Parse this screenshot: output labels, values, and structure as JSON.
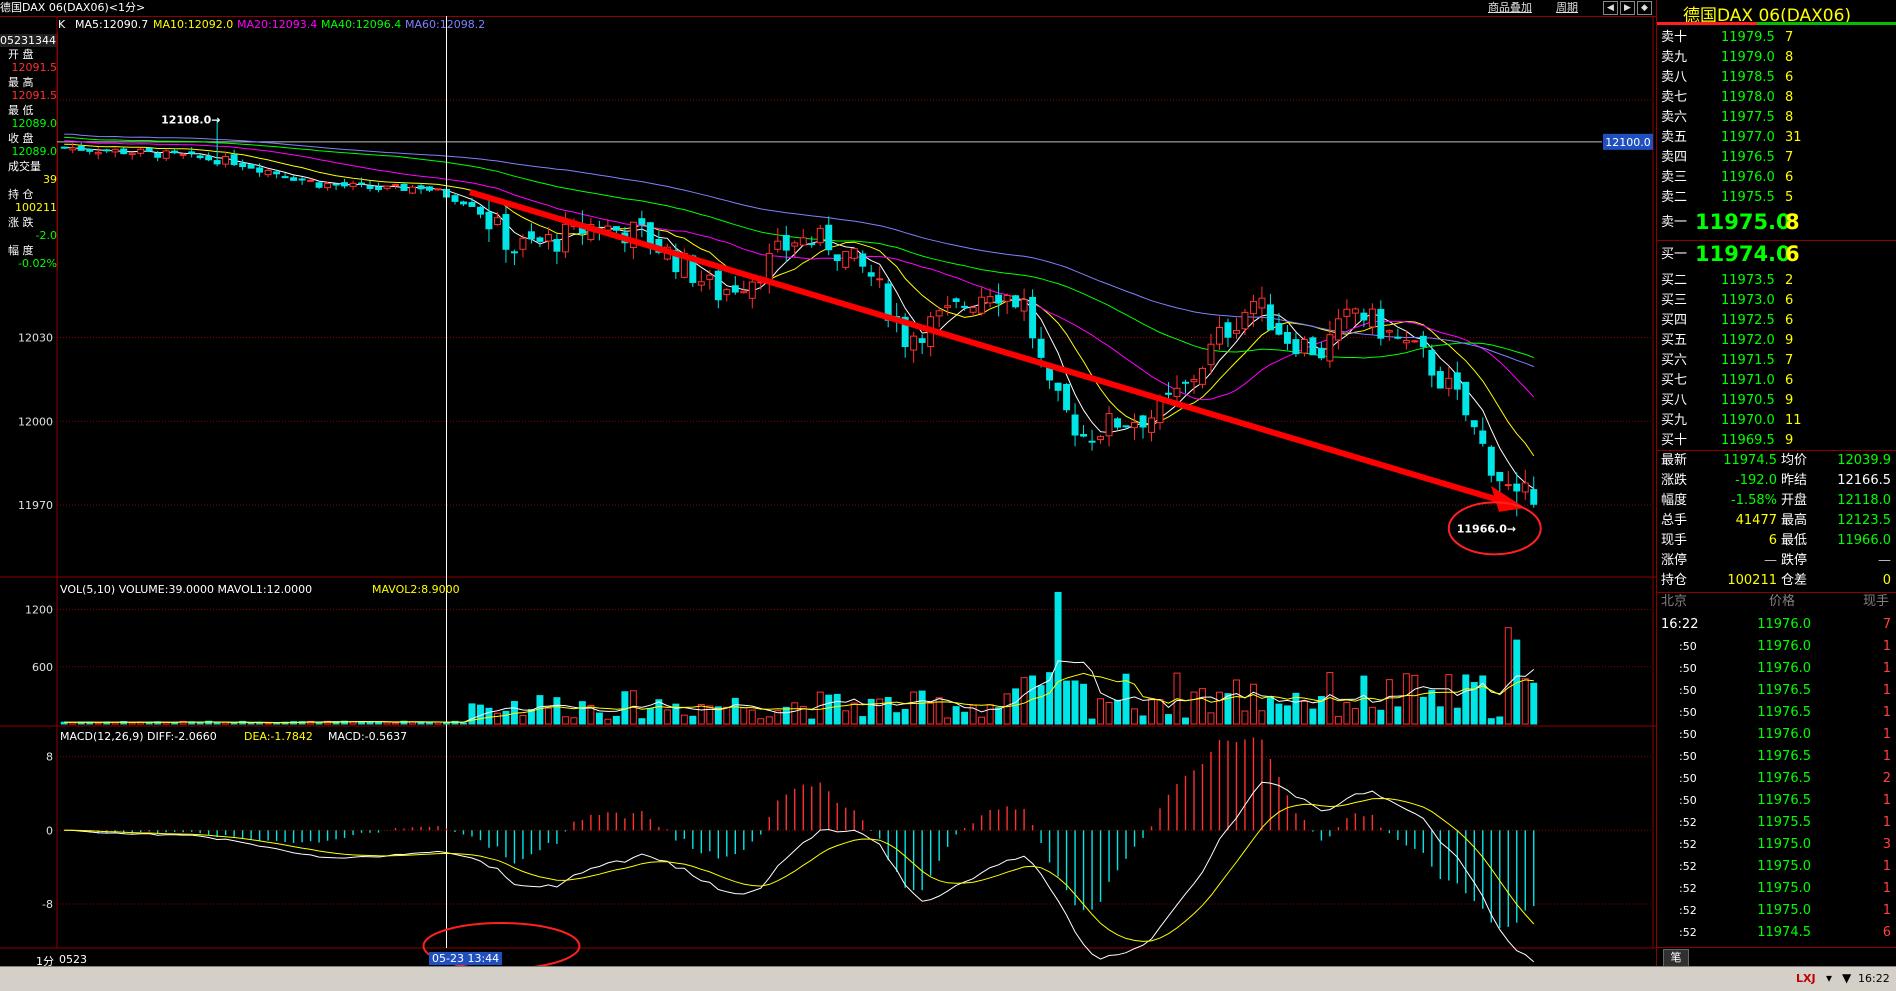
{
  "header": {
    "title": "德国DAX 06(DAX06)<1分>",
    "k_label": "K",
    "ma": [
      {
        "label": "MA5:12090.7",
        "color": "#ffffff"
      },
      {
        "label": "MA10:12092.0",
        "color": "#ffff00"
      },
      {
        "label": "MA20:12093.4",
        "color": "#ff00ff"
      },
      {
        "label": "MA40:12096.4",
        "color": "#00ff00"
      },
      {
        "label": "MA60:12098.2",
        "color": "#8080ff"
      }
    ],
    "links": [
      "商品叠加",
      "周期"
    ]
  },
  "left_info": {
    "date_code": "05231344",
    "rows": [
      {
        "label": "开 盘",
        "value": "12091.5",
        "color": "#ff3030"
      },
      {
        "label": "最 高",
        "value": "12091.5",
        "color": "#ff3030"
      },
      {
        "label": "最 低",
        "value": "12089.0",
        "color": "#00ff00"
      },
      {
        "label": "收 盘",
        "value": "12089.0",
        "color": "#00ff00"
      },
      {
        "label": "成交量",
        "value": "39",
        "color": "#ffff00"
      },
      {
        "label": "持 仓",
        "value": "100211",
        "color": "#ffff00"
      },
      {
        "label": "涨 跌",
        "value": "-2.0",
        "color": "#00ff00"
      },
      {
        "label": "幅 度",
        "value": "-0.02%",
        "color": "#00ff00"
      }
    ]
  },
  "price_axis": [
    "12030",
    "12000",
    "11970"
  ],
  "annotations": {
    "high_label": "12108.0→",
    "low_label": "11966.0→",
    "price_tag": "12100.0"
  },
  "volume": {
    "header": [
      "VOL(5,10)",
      "VOLUME:39.0000",
      "MAVOL1:12.0000",
      "MAVOL2:8.9000"
    ],
    "axis": [
      "1200",
      "600"
    ]
  },
  "macd": {
    "header": [
      "MACD(12,26,9)",
      "DIFF:-2.0660",
      "DEA:-1.7842",
      "MACD:-0.5637"
    ],
    "axis": [
      "8",
      "0",
      "-8"
    ]
  },
  "bottom": {
    "period": "1分",
    "date": "0523",
    "cursor_time": "05-23 13:44"
  },
  "chart_data": {
    "type": "candlestick",
    "title": "德国DAX 06(DAX06)<1分>",
    "ylim": [
      11945,
      12130
    ],
    "y_ticks": [
      12030,
      12000,
      11970
    ],
    "high": 12108.0,
    "low": 11966.0,
    "reference_line": 12100.0,
    "path": [
      {
        "i": 0,
        "p": 12098
      },
      {
        "i": 10,
        "p": 12096
      },
      {
        "i": 20,
        "p": 12093
      },
      {
        "i": 30,
        "p": 12085
      },
      {
        "i": 38,
        "p": 12083
      },
      {
        "i": 42,
        "p": 12084
      },
      {
        "i": 48,
        "p": 12078
      },
      {
        "i": 53,
        "p": 12062
      },
      {
        "i": 58,
        "p": 12065
      },
      {
        "i": 62,
        "p": 12070
      },
      {
        "i": 68,
        "p": 12067
      },
      {
        "i": 72,
        "p": 12058
      },
      {
        "i": 77,
        "p": 12046
      },
      {
        "i": 81,
        "p": 12052
      },
      {
        "i": 86,
        "p": 12065
      },
      {
        "i": 90,
        "p": 12064
      },
      {
        "i": 95,
        "p": 12052
      },
      {
        "i": 99,
        "p": 12030
      },
      {
        "i": 104,
        "p": 12038
      },
      {
        "i": 109,
        "p": 12048
      },
      {
        "i": 113,
        "p": 12042
      },
      {
        "i": 116,
        "p": 12010
      },
      {
        "i": 120,
        "p": 11995
      },
      {
        "i": 124,
        "p": 12000
      },
      {
        "i": 128,
        "p": 12002
      },
      {
        "i": 132,
        "p": 12012
      },
      {
        "i": 136,
        "p": 12030
      },
      {
        "i": 140,
        "p": 12043
      },
      {
        "i": 144,
        "p": 12030
      },
      {
        "i": 148,
        "p": 12025
      },
      {
        "i": 152,
        "p": 12040
      },
      {
        "i": 156,
        "p": 12031
      },
      {
        "i": 160,
        "p": 12023
      },
      {
        "i": 164,
        "p": 12008
      },
      {
        "i": 168,
        "p": 11985
      },
      {
        "i": 171,
        "p": 11971
      },
      {
        "i": 173,
        "p": 11975
      }
    ],
    "ma_series": [
      {
        "name": "MA5",
        "color": "#ffffff"
      },
      {
        "name": "MA10",
        "color": "#ffff00"
      },
      {
        "name": "MA20",
        "color": "#ff00ff"
      },
      {
        "name": "MA40",
        "color": "#00ff00"
      },
      {
        "name": "MA60",
        "color": "#8080ff"
      }
    ],
    "volume_ylim": [
      0,
      1500
    ],
    "macd_ylim": [
      -13,
      11
    ]
  },
  "quote": {
    "title": "德国DAX  06(DAX06)",
    "asks": [
      {
        "label": "卖十",
        "price": "11979.5",
        "vol": "7"
      },
      {
        "label": "卖九",
        "price": "11979.0",
        "vol": "8"
      },
      {
        "label": "卖八",
        "price": "11978.5",
        "vol": "6"
      },
      {
        "label": "卖七",
        "price": "11978.0",
        "vol": "8"
      },
      {
        "label": "卖六",
        "price": "11977.5",
        "vol": "8"
      },
      {
        "label": "卖五",
        "price": "11977.0",
        "vol": "31"
      },
      {
        "label": "卖四",
        "price": "11976.5",
        "vol": "7"
      },
      {
        "label": "卖三",
        "price": "11976.0",
        "vol": "6"
      },
      {
        "label": "卖二",
        "price": "11975.5",
        "vol": "5"
      }
    ],
    "ask1": {
      "label": "卖一",
      "price": "11975.0",
      "vol": "8"
    },
    "bid1": {
      "label": "买一",
      "price": "11974.0",
      "vol": "6"
    },
    "bids": [
      {
        "label": "买二",
        "price": "11973.5",
        "vol": "2"
      },
      {
        "label": "买三",
        "price": "11973.0",
        "vol": "6"
      },
      {
        "label": "买四",
        "price": "11972.5",
        "vol": "6"
      },
      {
        "label": "买五",
        "price": "11972.0",
        "vol": "9"
      },
      {
        "label": "买六",
        "price": "11971.5",
        "vol": "7"
      },
      {
        "label": "买七",
        "price": "11971.0",
        "vol": "6"
      },
      {
        "label": "买八",
        "price": "11970.5",
        "vol": "9"
      },
      {
        "label": "买九",
        "price": "11970.0",
        "vol": "11"
      },
      {
        "label": "买十",
        "price": "11969.5",
        "vol": "9"
      }
    ],
    "stats": [
      {
        "l1": "最新",
        "v1": "11974.5",
        "c1": "#00ff00",
        "l2": "均价",
        "v2": "12039.9",
        "c2": "#00ff00"
      },
      {
        "l1": "涨跌",
        "v1": "-192.0",
        "c1": "#00ff00",
        "l2": "昨结",
        "v2": "12166.5",
        "c2": "#ffffff"
      },
      {
        "l1": "幅度",
        "v1": "-1.58%",
        "c1": "#00ff00",
        "l2": "开盘",
        "v2": "12118.0",
        "c2": "#00ff00"
      },
      {
        "l1": "总手",
        "v1": "41477",
        "c1": "#ffff00",
        "l2": "最高",
        "v2": "12123.5",
        "c2": "#00ff00"
      },
      {
        "l1": "现手",
        "v1": "6",
        "c1": "#ffff00",
        "l2": "最低",
        "v2": "11966.0",
        "c2": "#00ff00"
      },
      {
        "l1": "涨停",
        "v1": "—",
        "c1": "#c0c0c0",
        "l2": "跌停",
        "v2": "—",
        "c2": "#c0c0c0"
      },
      {
        "l1": "持仓",
        "v1": "100211",
        "c1": "#ffff00",
        "l2": "仓差",
        "v2": "0",
        "c2": "#ffff00"
      }
    ],
    "trade_header": [
      "北京",
      "价格",
      "现手"
    ],
    "trades": [
      {
        "time": "16:22",
        "price": "11976.0",
        "vol": "7"
      },
      {
        "time": ":50",
        "price": "11976.0",
        "vol": "1"
      },
      {
        "time": ":50",
        "price": "11976.0",
        "vol": "1"
      },
      {
        "time": ":50",
        "price": "11976.5",
        "vol": "1"
      },
      {
        "time": ":50",
        "price": "11976.5",
        "vol": "1"
      },
      {
        "time": ":50",
        "price": "11976.0",
        "vol": "1"
      },
      {
        "time": ":50",
        "price": "11976.5",
        "vol": "1"
      },
      {
        "time": ":50",
        "price": "11976.5",
        "vol": "2"
      },
      {
        "time": ":50",
        "price": "11976.5",
        "vol": "1"
      },
      {
        "time": ":52",
        "price": "11975.5",
        "vol": "1"
      },
      {
        "time": ":52",
        "price": "11975.0",
        "vol": "3"
      },
      {
        "time": ":52",
        "price": "11975.0",
        "vol": "1"
      },
      {
        "time": ":52",
        "price": "11975.0",
        "vol": "1"
      },
      {
        "time": ":52",
        "price": "11975.0",
        "vol": "1"
      },
      {
        "time": ":52",
        "price": "11974.5",
        "vol": "6"
      }
    ],
    "tab": "笔"
  },
  "status": {
    "time": "16:22",
    "indicator": "LXJ"
  }
}
